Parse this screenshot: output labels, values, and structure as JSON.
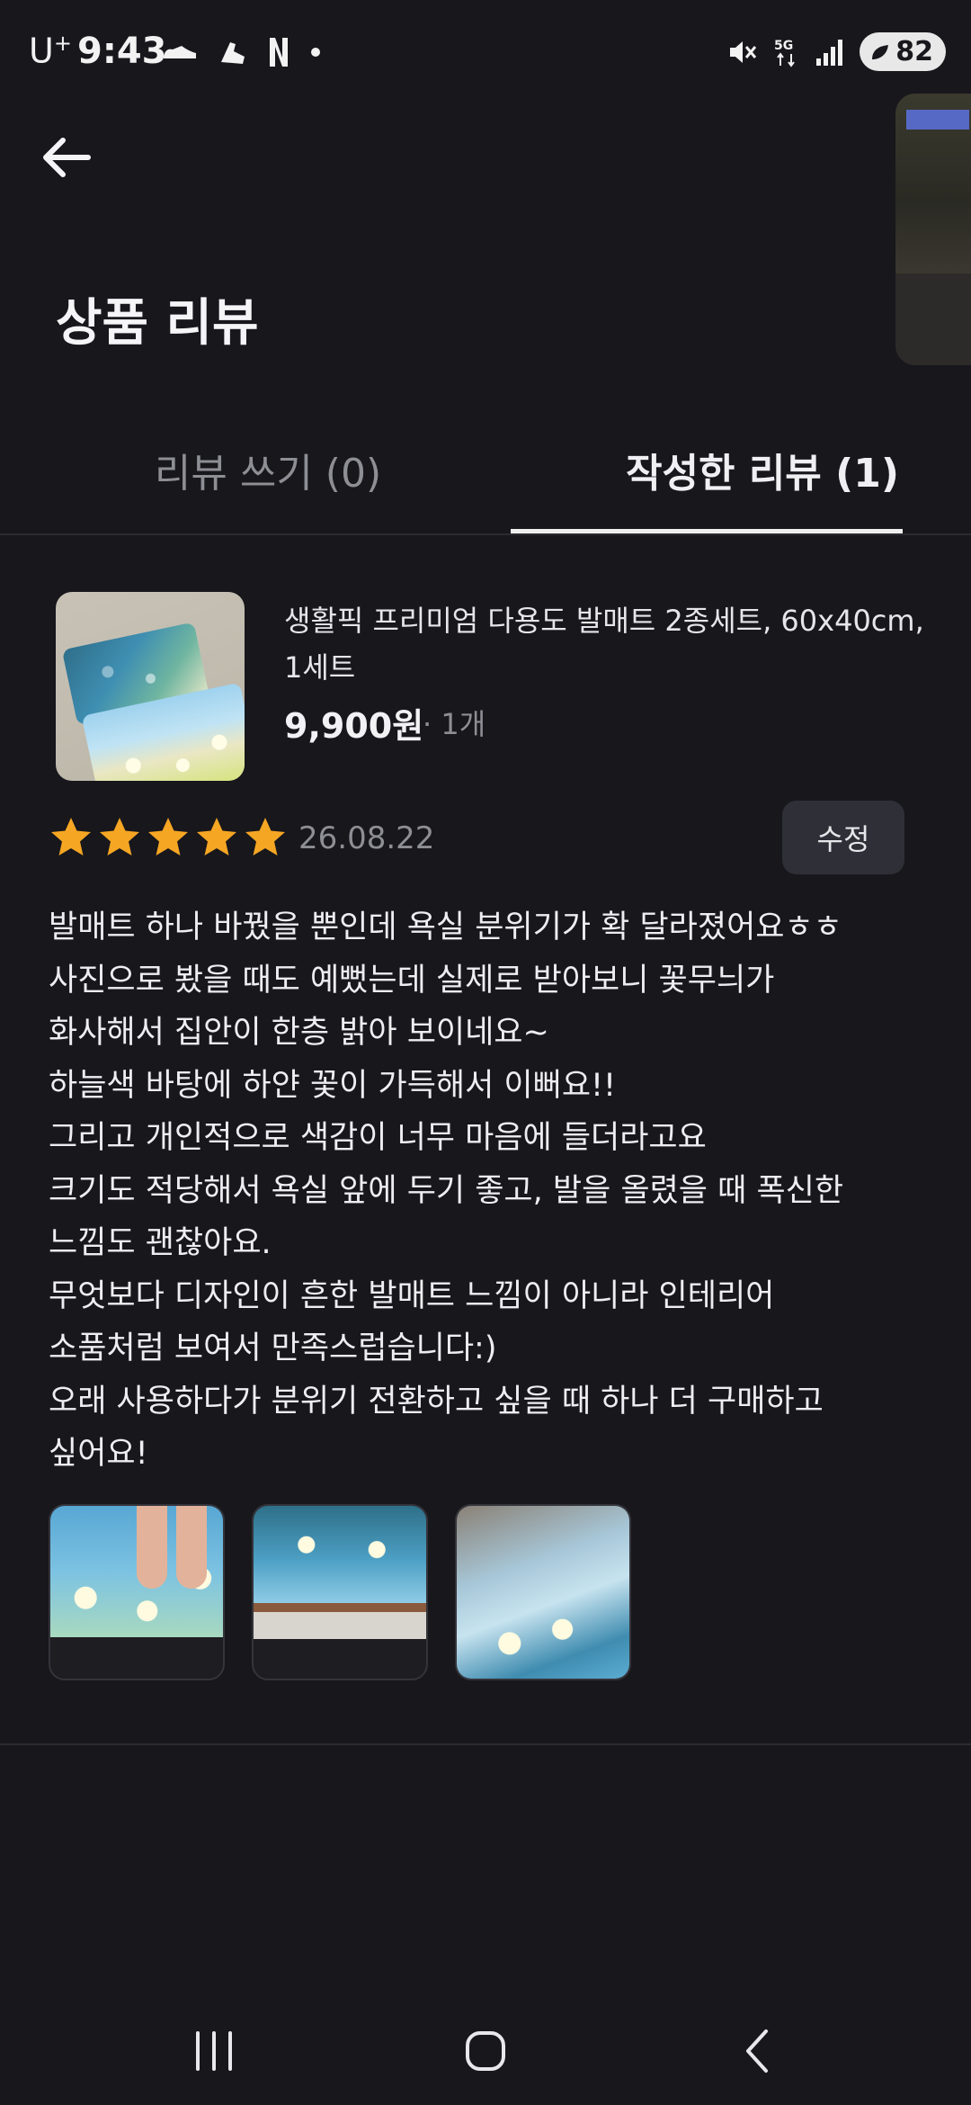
{
  "status_bar": {
    "carrier": "U",
    "carrier_sup": "+",
    "time": "9:43",
    "battery": "82",
    "network": "5G"
  },
  "header": {
    "title": "상품 리뷰"
  },
  "tabs": [
    {
      "label": "리뷰 쓰기 (0)",
      "selected": false
    },
    {
      "label": "작성한 리뷰 (1)",
      "selected": true
    }
  ],
  "product": {
    "name": "생활픽 프리미엄 다용도 발매트 2종세트, 60x40cm, 1세트",
    "price": "9,900원",
    "quantity": "· 1개"
  },
  "review": {
    "rating": 5,
    "date": "26.08.22",
    "edit_label": "수정",
    "text": "발매트 하나 바꿨을 뿐인데 욕실 분위기가 확 달라졌어요ㅎㅎ\n사진으로 봤을 때도 예뻤는데 실제로 받아보니 꽃무늬가\n화사해서 집안이 한층 밝아 보이네요~\n하늘색 바탕에 하얀 꽃이 가득해서 이뻐요!!\n그리고 개인적으로 색감이 너무 마음에 들더라고요\n크기도 적당해서 욕실 앞에 두기 좋고, 발을 올렸을 때 폭신한\n느낌도 괜찮아요.\n무엇보다 디자인이 흔한 발매트 느낌이 아니라 인테리어\n소품처럼 보여서 만족스럽습니다:)\n오래 사용하다가 분위기 전환하고 싶을 때 하나 더 구매하고\n싶어요!",
    "photo_count": 3
  },
  "colors": {
    "background": "#17171c",
    "star": "#f5a623",
    "button_bg": "#2f3037",
    "muted_text": "#8e8e95"
  },
  "icons": {
    "back": "arrow-left-icon",
    "star": "star-icon",
    "nav_recents": "recents-icon",
    "nav_home": "home-icon",
    "nav_back": "chevron-left-icon"
  }
}
